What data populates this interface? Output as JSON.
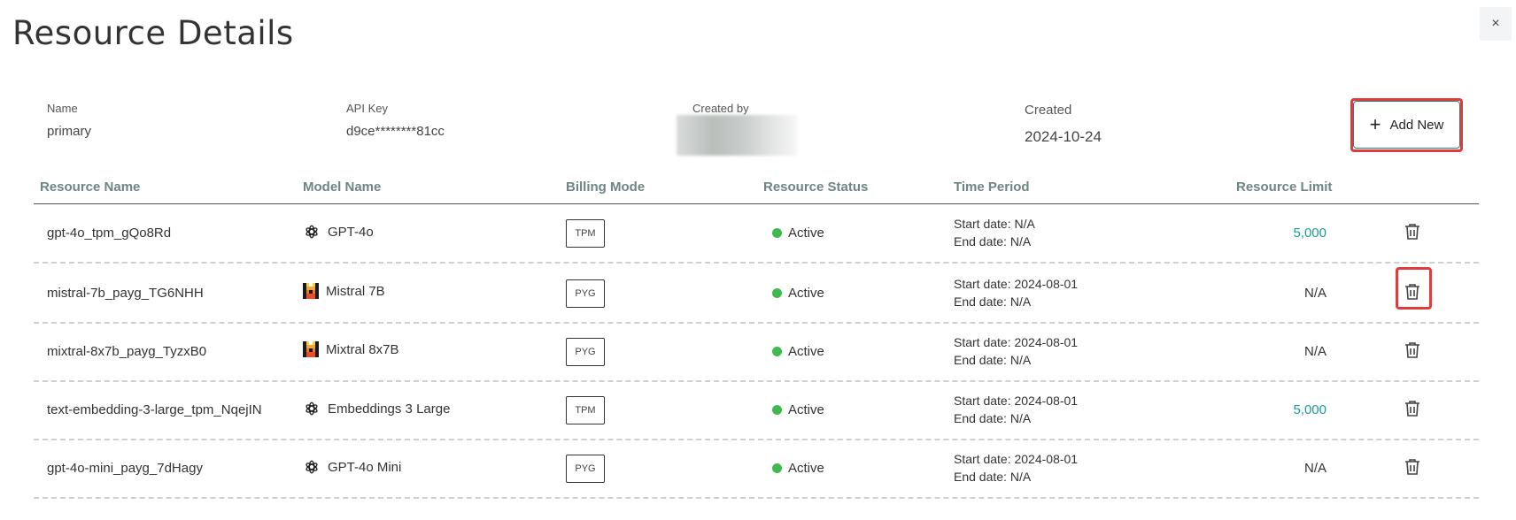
{
  "page": {
    "title": "Resource Details",
    "close_label": "×"
  },
  "meta": {
    "name_label": "Name",
    "name_value": "primary",
    "api_key_label": "API Key",
    "api_key_value": "d9ce********81cc",
    "created_by_label": "Created by",
    "created_label": "Created",
    "created_value": "2024-10-24"
  },
  "add_new": {
    "label": "Add New",
    "icon": "plus-icon"
  },
  "table": {
    "columns": [
      "Resource Name",
      "Model Name",
      "Billing Mode",
      "Resource Status",
      "Time Period",
      "Resource Limit"
    ],
    "rows": [
      {
        "resource_name": "gpt-4o_tpm_gQo8Rd",
        "model_icon": "openai-icon",
        "model_name": "GPT-4o",
        "billing": "TPM",
        "status": "Active",
        "start": "Start date: N/A",
        "end": "End date: N/A",
        "limit": "5,000"
      },
      {
        "resource_name": "mistral-7b_payg_TG6NHH",
        "model_icon": "mistral-icon",
        "model_name": "Mistral 7B",
        "billing": "PYG",
        "status": "Active",
        "start": "Start date: 2024-08-01",
        "end": "End date: N/A",
        "limit": "N/A"
      },
      {
        "resource_name": "mixtral-8x7b_payg_TyzxB0",
        "model_icon": "mistral-icon",
        "model_name": "Mixtral 8x7B",
        "billing": "PYG",
        "status": "Active",
        "start": "Start date: 2024-08-01",
        "end": "End date: N/A",
        "limit": "N/A"
      },
      {
        "resource_name": "text-embedding-3-large_tpm_NqejIN",
        "model_icon": "openai-icon",
        "model_name": "Embeddings 3 Large",
        "billing": "TPM",
        "status": "Active",
        "start": "Start date: 2024-08-01",
        "end": "End date: N/A",
        "limit": "5,000"
      },
      {
        "resource_name": "gpt-4o-mini_payg_7dHagy",
        "model_icon": "openai-icon",
        "model_name": "GPT-4o Mini",
        "billing": "PYG",
        "status": "Active",
        "start": "Start date: 2024-08-01",
        "end": "End date: N/A",
        "limit": "N/A"
      }
    ]
  },
  "colors": {
    "accent_teal": "#1a9e96",
    "status_active": "#3fb950",
    "highlight": "#e03c3c",
    "header_text": "#6e8583"
  }
}
